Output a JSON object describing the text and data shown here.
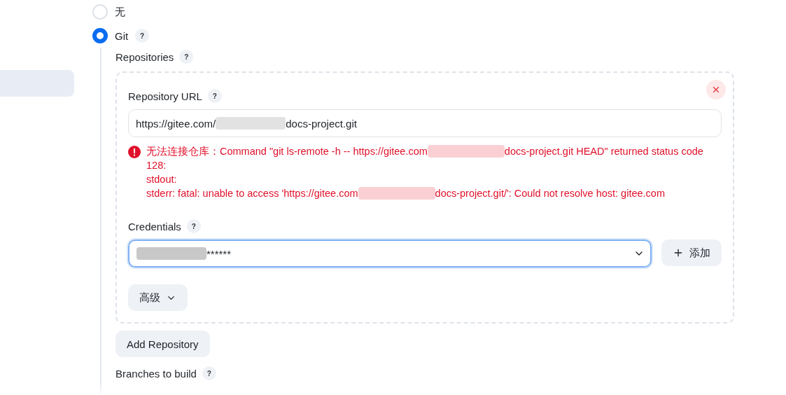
{
  "sidebar": {
    "items": [
      {
        "selected": true
      }
    ]
  },
  "scm_options": [
    {
      "label": "无",
      "selected": false
    },
    {
      "label": "Git",
      "selected": true,
      "help": "?"
    }
  ],
  "repositories": {
    "label": "Repositories",
    "help": "?",
    "items": [
      {
        "url_label": "Repository URL",
        "url_help": "?",
        "url_before": "https://gitee.com/",
        "url_after": "docs-project.git",
        "error": {
          "lines": [
            {
              "before": "无法连接仓库：Command \"git ls-remote -h -- https://gitee.com",
              "after": "docs-project.git HEAD\" returned status code"
            },
            {
              "before": "128:"
            },
            {
              "before": "stdout:"
            },
            {
              "before": "stderr: fatal: unable to access 'https://gitee.com",
              "after": "docs-project.git/': Could not resolve host: gitee.com"
            }
          ]
        },
        "credentials_label": "Credentials",
        "credentials_help": "?",
        "credentials_value": "******",
        "add_button": "添加",
        "advanced_button": "高级"
      }
    ],
    "add_button": "Add Repository"
  },
  "branches_label": "Branches to build",
  "branches_help": "?"
}
